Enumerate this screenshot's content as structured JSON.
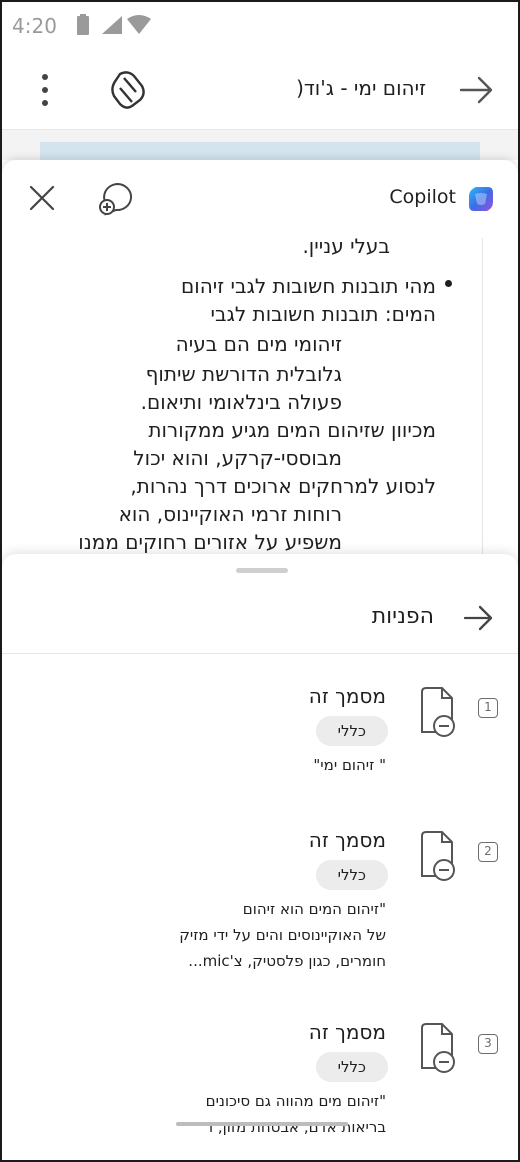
{
  "status_bar": {
    "time": "4:20"
  },
  "app_bar": {
    "document_title": "זיהום ימי - ג'וד("
  },
  "copilot": {
    "title": "Copilot"
  },
  "answer": {
    "partial_line": "בעלי עניין.",
    "lines": [
      "מהי תובנות חשובות לגבי זיהום",
      "המים: תובנות חשובות לגבי",
      "זיהומי מים הם בעיה",
      "גלובלית הדורשת שיתוף",
      "פעולה בינלאומי ותיאום.",
      "מכיוון שזיהום המים מגיע ממקורות",
      "מבוססי-קרקע, והוא יכול",
      "לנסוע למרחקים ארוכים דרך נהרות,",
      "רוחות זרמי האוקיינוס, הוא",
      "משפיע על אזורים רחוקים ממנו"
    ]
  },
  "references": {
    "title": "הפניות",
    "items": [
      {
        "number": "1",
        "title": "מסמך זה",
        "tag": "כללי",
        "snippet": [
          "\" זיהום ימי\""
        ]
      },
      {
        "number": "2",
        "title": "מסמך זה",
        "tag": "כללי",
        "snippet": [
          "\"זיהום המים הוא זיהום",
          "של האוקיינוסים והים על ידי מזיק",
          "חומרים, כגון פלסטיק, צ'mic..."
        ]
      },
      {
        "number": "3",
        "title": "מסמך זה",
        "tag": "כללי",
        "snippet": [
          "\"זיהום מים מהווה גם סיכונים",
          "בריאות אדם, אבטחת מזון, ו"
        ]
      }
    ]
  },
  "colors": {
    "text": "#1f1f1f",
    "status_gray": "#9a9a9a",
    "pill_bg": "#ececec",
    "strip_blue": "#d4e4ef"
  }
}
